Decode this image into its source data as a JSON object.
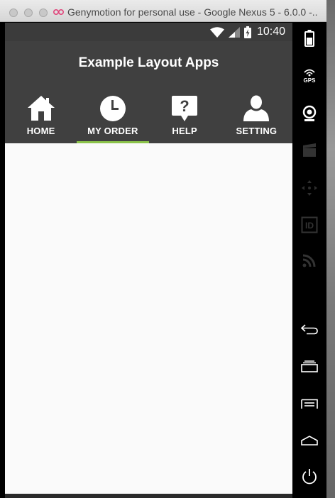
{
  "window": {
    "title": "Genymotion for personal use - Google Nexus 5 - 6.0.0 -..."
  },
  "status_bar": {
    "time": "10:40",
    "icons": [
      "wifi-icon",
      "cellular-signal-icon",
      "battery-charging-icon"
    ]
  },
  "app": {
    "title": "Example Layout Apps",
    "tabs": [
      {
        "label": "HOME",
        "icon": "home-icon",
        "selected": false
      },
      {
        "label": "MY ORDER",
        "icon": "clock-icon",
        "selected": true
      },
      {
        "label": "HELP",
        "icon": "help-bubble-icon",
        "selected": false
      },
      {
        "label": "SETTING",
        "icon": "user-icon",
        "selected": false
      }
    ],
    "accent_color": "#8bc34a",
    "toolbar_color": "#404040",
    "status_bar_color": "#3b3b3b"
  },
  "sidebar": {
    "buttons": [
      {
        "name": "battery",
        "icon": "battery-icon"
      },
      {
        "name": "gps",
        "icon": "gps-icon",
        "label": "GPS"
      },
      {
        "name": "webcam",
        "icon": "webcam-icon"
      },
      {
        "name": "capture",
        "icon": "clapper-icon"
      },
      {
        "name": "remote-control",
        "icon": "dpad-icon"
      },
      {
        "name": "identifiers",
        "icon": "id-icon",
        "label": "ID"
      },
      {
        "name": "cast",
        "icon": "cast-icon"
      },
      {
        "name": "back",
        "icon": "back-icon"
      },
      {
        "name": "recent-apps",
        "icon": "recent-apps-icon"
      },
      {
        "name": "menu",
        "icon": "menu-icon"
      },
      {
        "name": "home",
        "icon": "home-outline-icon"
      },
      {
        "name": "power",
        "icon": "power-icon"
      }
    ]
  }
}
